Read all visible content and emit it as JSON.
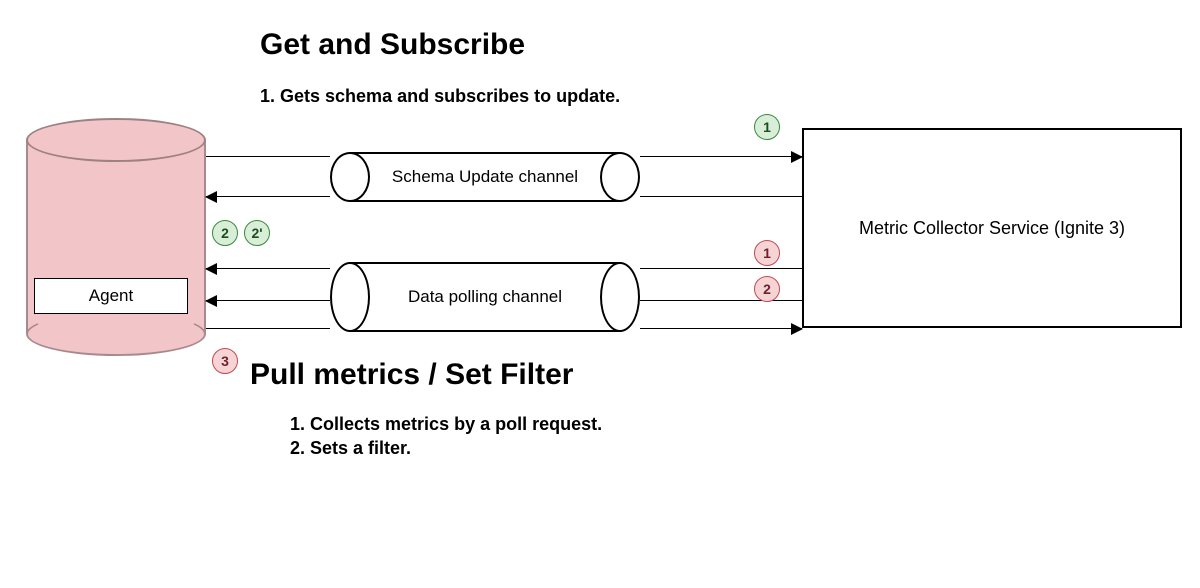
{
  "titles": {
    "section1": "Get and Subscribe",
    "section1_sub": "1. Gets schema and subscribes to update.",
    "section2": "Pull metrics / Set Filter",
    "section2_sub_a": "1. Collects metrics by a poll request.",
    "section2_sub_b": "2. Sets a filter."
  },
  "components": {
    "agent_label": "Agent",
    "collector_label": "Metric Collector Service (Ignite 3)",
    "channel_schema_label": "Schema Update channel",
    "channel_data_label": "Data polling channel"
  },
  "badges": {
    "green_1": "1",
    "green_2": "2",
    "green_2p": "2'",
    "red_1": "1",
    "red_2": "2",
    "red_3": "3"
  }
}
